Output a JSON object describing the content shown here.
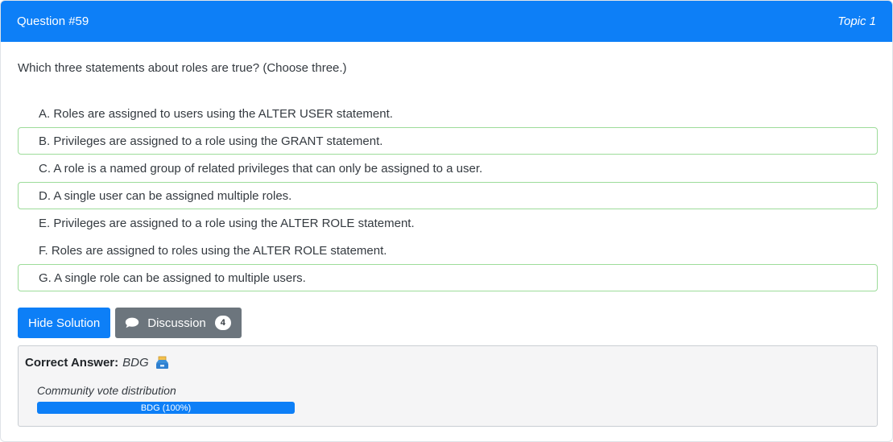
{
  "header": {
    "title": "Question #59",
    "topic": "Topic 1"
  },
  "question": {
    "text": "Which three statements about roles are true? (Choose three.)"
  },
  "choices": [
    {
      "text": "A. Roles are assigned to users using the ALTER USER statement.",
      "correct": false
    },
    {
      "text": "B. Privileges are assigned to a role using the GRANT statement.",
      "correct": true
    },
    {
      "text": "C. A role is a named group of related privileges that can only be assigned to a user.",
      "correct": false
    },
    {
      "text": "D. A single user can be assigned multiple roles.",
      "correct": true
    },
    {
      "text": "E. Privileges are assigned to a role using the ALTER ROLE statement.",
      "correct": false
    },
    {
      "text": "F. Roles are assigned to roles using the ALTER ROLE statement.",
      "correct": false
    },
    {
      "text": "G. A single role can be assigned to multiple users.",
      "correct": true
    }
  ],
  "buttons": {
    "hide_solution": "Hide Solution",
    "discussion": "Discussion",
    "discussion_count": "4",
    "discussion_icon": "chat-bubble-icon"
  },
  "answer": {
    "label": "Correct Answer:",
    "value": "BDG",
    "icon": "inbox-tray-icon",
    "vote_title": "Community vote distribution",
    "vote_label": "BDG (100%)",
    "vote_percent": 100
  },
  "colors": {
    "primary": "#0d7ff7",
    "secondary": "#6c757d",
    "correct_border": "#9ddc9a",
    "answer_bg": "#f5f5f6"
  }
}
